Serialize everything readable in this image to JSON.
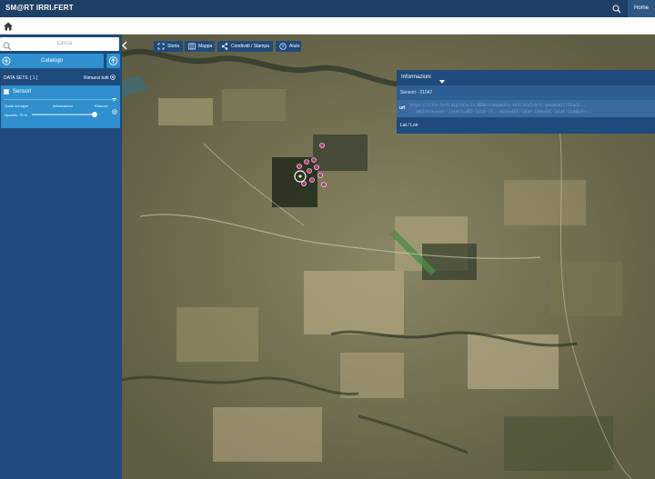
{
  "app": {
    "brand": "SM@RT IRRI.FERT",
    "home_label": "Home"
  },
  "sidebar": {
    "search_placeholder": "Cerca",
    "catalog_label": "Catalogo",
    "datasets_label": "DATA SETS",
    "datasets_count": "[ 1 ]",
    "remove_all_label": "Rimuovi tutti",
    "layer": {
      "name": "Sensori",
      "zoom_label": "Zoom sul layer",
      "info_label": "Informazioni",
      "remove_label": "Rimuovi",
      "opacity_label": "Opacità: 75 %",
      "opacity_value": 0.75
    }
  },
  "map_toolbar": {
    "history": "Storia",
    "map": "Mappa",
    "share": "Condividi / Stampa",
    "help": "Aiuto"
  },
  "info_panel": {
    "title": "Informazioni",
    "sensor": "Sensori - 21047",
    "url_key": "url",
    "url_value": "https://iitrv-fert.digitale.it:8080/v/mapanalv-tol1:4/v5-mrtc-geonode12:52ap1c...",
    "url_value_2": "...amm1stre=sens-.jsonsrc=OCC-lalat-if...l&lon=OCC-lalat-ionm=OCC-lalat-ionm&Lon...",
    "latlon_label": "Lat / Lon"
  },
  "colors": {
    "topbar": "#1e3f66",
    "sidebar": "#1f4a7c",
    "accent": "#2f8fcf",
    "sensor_marker": "#c03080"
  },
  "icons": [
    "search-icon",
    "home-icon",
    "plus-circle-icon",
    "upload-icon",
    "checkbox-icon",
    "chevron-down-icon",
    "info-icon",
    "close-icon",
    "history-icon",
    "map-icon",
    "share-icon",
    "help-icon",
    "collapse-left-icon",
    "sensor-marker-icon"
  ]
}
